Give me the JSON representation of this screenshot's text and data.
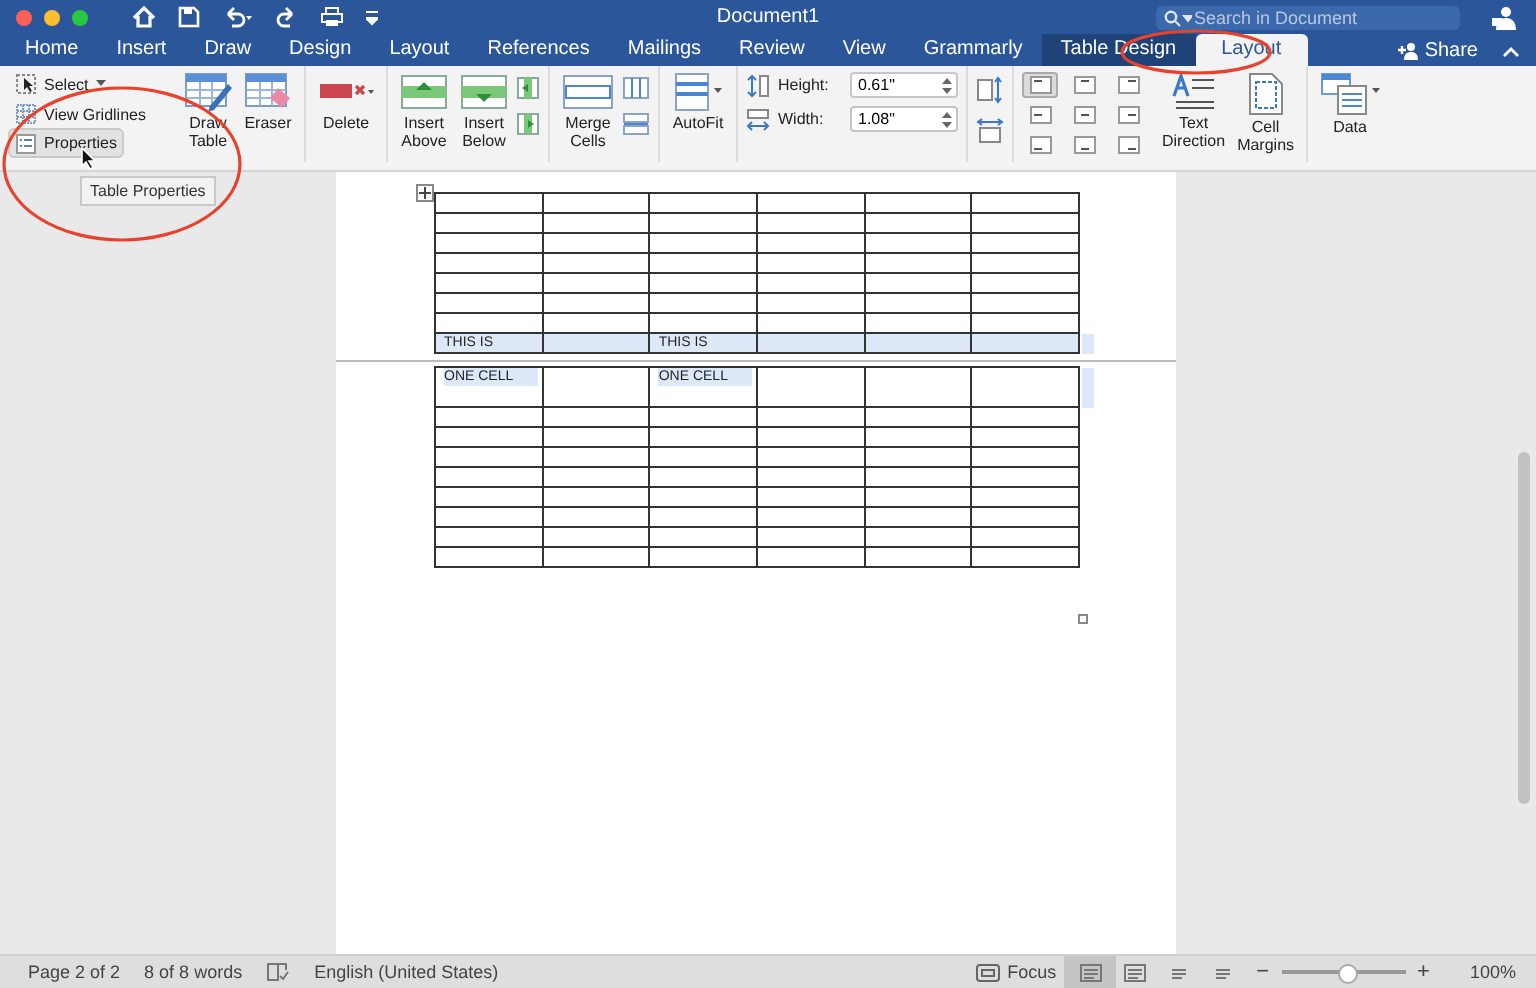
{
  "window": {
    "title": "Document1"
  },
  "search": {
    "placeholder": "Search in Document"
  },
  "tabs": [
    {
      "label": "Home",
      "selected": false,
      "contextual": false
    },
    {
      "label": "Insert",
      "selected": false,
      "contextual": false
    },
    {
      "label": "Draw",
      "selected": false,
      "contextual": false
    },
    {
      "label": "Design",
      "selected": false,
      "contextual": false
    },
    {
      "label": "Layout",
      "selected": false,
      "contextual": false
    },
    {
      "label": "References",
      "selected": false,
      "contextual": false
    },
    {
      "label": "Mailings",
      "selected": false,
      "contextual": false
    },
    {
      "label": "Review",
      "selected": false,
      "contextual": false
    },
    {
      "label": "View",
      "selected": false,
      "contextual": false
    },
    {
      "label": "Grammarly",
      "selected": false,
      "contextual": false
    },
    {
      "label": "Table Design",
      "selected": false,
      "contextual": true
    },
    {
      "label": "Layout",
      "selected": true,
      "contextual": true
    }
  ],
  "share": {
    "label": "Share"
  },
  "ribbon": {
    "table_group": [
      {
        "label": "Select",
        "hovered": false
      },
      {
        "label": "View Gridlines",
        "hovered": false
      },
      {
        "label": "Properties",
        "hovered": true
      }
    ],
    "tooltip": "Table Properties",
    "buttons": [
      {
        "label": "Draw Table"
      },
      {
        "label": "Eraser"
      },
      {
        "label": "Delete"
      },
      {
        "label": "Insert Above"
      },
      {
        "label": "Insert Below"
      },
      {
        "label": "Merge Cells"
      },
      {
        "label": "AutoFit"
      }
    ],
    "height": {
      "label": "Height:",
      "value": "0.61\""
    },
    "width": {
      "label": "Width:",
      "value": "1.08\""
    },
    "alignments": [
      {
        "selected": true
      },
      {
        "selected": false
      },
      {
        "selected": false
      },
      {
        "selected": false
      },
      {
        "selected": false
      },
      {
        "selected": false
      },
      {
        "selected": false
      },
      {
        "selected": false
      },
      {
        "selected": false
      }
    ],
    "end_buttons": [
      {
        "label": "Text Direction"
      },
      {
        "label": "Cell Margins"
      },
      {
        "label": "Data"
      }
    ]
  },
  "table": {
    "pages": [
      {
        "rows": [
          {
            "selected": false,
            "cells": [
              "",
              "",
              "",
              "",
              "",
              ""
            ]
          },
          {
            "selected": false,
            "cells": [
              "",
              "",
              "",
              "",
              "",
              ""
            ]
          },
          {
            "selected": false,
            "cells": [
              "",
              "",
              "",
              "",
              "",
              ""
            ]
          },
          {
            "selected": false,
            "cells": [
              "",
              "",
              "",
              "",
              "",
              ""
            ]
          },
          {
            "selected": false,
            "cells": [
              "",
              "",
              "",
              "",
              "",
              ""
            ]
          },
          {
            "selected": false,
            "cells": [
              "",
              "",
              "",
              "",
              "",
              ""
            ]
          },
          {
            "selected": false,
            "cells": [
              "",
              "",
              "",
              "",
              "",
              ""
            ]
          },
          {
            "selected": true,
            "cells": [
              "THIS IS",
              "",
              "THIS IS",
              "",
              "",
              ""
            ]
          }
        ]
      },
      {
        "rows": [
          {
            "selected": true,
            "cells": [
              "ONE CELL",
              "",
              "ONE CELL",
              "",
              "",
              ""
            ]
          },
          {
            "selected": false,
            "cells": [
              "",
              "",
              "",
              "",
              "",
              ""
            ]
          },
          {
            "selected": false,
            "cells": [
              "",
              "",
              "",
              "",
              "",
              ""
            ]
          },
          {
            "selected": false,
            "cells": [
              "",
              "",
              "",
              "",
              "",
              ""
            ]
          },
          {
            "selected": false,
            "cells": [
              "",
              "",
              "",
              "",
              "",
              ""
            ]
          },
          {
            "selected": false,
            "cells": [
              "",
              "",
              "",
              "",
              "",
              ""
            ]
          },
          {
            "selected": false,
            "cells": [
              "",
              "",
              "",
              "",
              "",
              ""
            ]
          },
          {
            "selected": false,
            "cells": [
              "",
              "",
              "",
              "",
              "",
              ""
            ]
          },
          {
            "selected": false,
            "cells": [
              "",
              "",
              "",
              "",
              "",
              ""
            ]
          }
        ]
      }
    ]
  },
  "status_bar": {
    "page": "Page 2 of 2",
    "words": "8 of 8 words",
    "language": "English (United States)",
    "focus": "Focus",
    "views": [
      {
        "selected": true
      },
      {
        "selected": false
      },
      {
        "selected": false
      },
      {
        "selected": false
      }
    ],
    "zoom": {
      "minus": "−",
      "plus": "+",
      "level": 0.53,
      "reading": "100%"
    }
  }
}
